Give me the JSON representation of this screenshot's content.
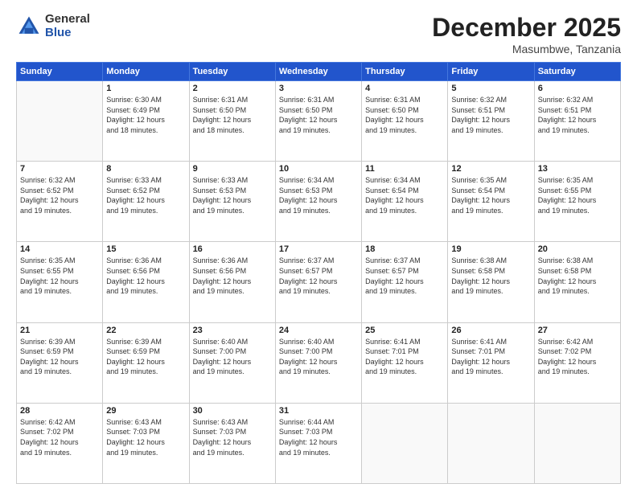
{
  "logo": {
    "general": "General",
    "blue": "Blue"
  },
  "title": {
    "month_year": "December 2025",
    "location": "Masumbwe, Tanzania"
  },
  "days_of_week": [
    "Sunday",
    "Monday",
    "Tuesday",
    "Wednesday",
    "Thursday",
    "Friday",
    "Saturday"
  ],
  "weeks": [
    [
      {
        "day": "",
        "info": ""
      },
      {
        "day": "1",
        "info": "Sunrise: 6:30 AM\nSunset: 6:49 PM\nDaylight: 12 hours\nand 18 minutes."
      },
      {
        "day": "2",
        "info": "Sunrise: 6:31 AM\nSunset: 6:50 PM\nDaylight: 12 hours\nand 18 minutes."
      },
      {
        "day": "3",
        "info": "Sunrise: 6:31 AM\nSunset: 6:50 PM\nDaylight: 12 hours\nand 19 minutes."
      },
      {
        "day": "4",
        "info": "Sunrise: 6:31 AM\nSunset: 6:50 PM\nDaylight: 12 hours\nand 19 minutes."
      },
      {
        "day": "5",
        "info": "Sunrise: 6:32 AM\nSunset: 6:51 PM\nDaylight: 12 hours\nand 19 minutes."
      },
      {
        "day": "6",
        "info": "Sunrise: 6:32 AM\nSunset: 6:51 PM\nDaylight: 12 hours\nand 19 minutes."
      }
    ],
    [
      {
        "day": "7",
        "info": "Sunrise: 6:32 AM\nSunset: 6:52 PM\nDaylight: 12 hours\nand 19 minutes."
      },
      {
        "day": "8",
        "info": "Sunrise: 6:33 AM\nSunset: 6:52 PM\nDaylight: 12 hours\nand 19 minutes."
      },
      {
        "day": "9",
        "info": "Sunrise: 6:33 AM\nSunset: 6:53 PM\nDaylight: 12 hours\nand 19 minutes."
      },
      {
        "day": "10",
        "info": "Sunrise: 6:34 AM\nSunset: 6:53 PM\nDaylight: 12 hours\nand 19 minutes."
      },
      {
        "day": "11",
        "info": "Sunrise: 6:34 AM\nSunset: 6:54 PM\nDaylight: 12 hours\nand 19 minutes."
      },
      {
        "day": "12",
        "info": "Sunrise: 6:35 AM\nSunset: 6:54 PM\nDaylight: 12 hours\nand 19 minutes."
      },
      {
        "day": "13",
        "info": "Sunrise: 6:35 AM\nSunset: 6:55 PM\nDaylight: 12 hours\nand 19 minutes."
      }
    ],
    [
      {
        "day": "14",
        "info": "Sunrise: 6:35 AM\nSunset: 6:55 PM\nDaylight: 12 hours\nand 19 minutes."
      },
      {
        "day": "15",
        "info": "Sunrise: 6:36 AM\nSunset: 6:56 PM\nDaylight: 12 hours\nand 19 minutes."
      },
      {
        "day": "16",
        "info": "Sunrise: 6:36 AM\nSunset: 6:56 PM\nDaylight: 12 hours\nand 19 minutes."
      },
      {
        "day": "17",
        "info": "Sunrise: 6:37 AM\nSunset: 6:57 PM\nDaylight: 12 hours\nand 19 minutes."
      },
      {
        "day": "18",
        "info": "Sunrise: 6:37 AM\nSunset: 6:57 PM\nDaylight: 12 hours\nand 19 minutes."
      },
      {
        "day": "19",
        "info": "Sunrise: 6:38 AM\nSunset: 6:58 PM\nDaylight: 12 hours\nand 19 minutes."
      },
      {
        "day": "20",
        "info": "Sunrise: 6:38 AM\nSunset: 6:58 PM\nDaylight: 12 hours\nand 19 minutes."
      }
    ],
    [
      {
        "day": "21",
        "info": "Sunrise: 6:39 AM\nSunset: 6:59 PM\nDaylight: 12 hours\nand 19 minutes."
      },
      {
        "day": "22",
        "info": "Sunrise: 6:39 AM\nSunset: 6:59 PM\nDaylight: 12 hours\nand 19 minutes."
      },
      {
        "day": "23",
        "info": "Sunrise: 6:40 AM\nSunset: 7:00 PM\nDaylight: 12 hours\nand 19 minutes."
      },
      {
        "day": "24",
        "info": "Sunrise: 6:40 AM\nSunset: 7:00 PM\nDaylight: 12 hours\nand 19 minutes."
      },
      {
        "day": "25",
        "info": "Sunrise: 6:41 AM\nSunset: 7:01 PM\nDaylight: 12 hours\nand 19 minutes."
      },
      {
        "day": "26",
        "info": "Sunrise: 6:41 AM\nSunset: 7:01 PM\nDaylight: 12 hours\nand 19 minutes."
      },
      {
        "day": "27",
        "info": "Sunrise: 6:42 AM\nSunset: 7:02 PM\nDaylight: 12 hours\nand 19 minutes."
      }
    ],
    [
      {
        "day": "28",
        "info": "Sunrise: 6:42 AM\nSunset: 7:02 PM\nDaylight: 12 hours\nand 19 minutes."
      },
      {
        "day": "29",
        "info": "Sunrise: 6:43 AM\nSunset: 7:03 PM\nDaylight: 12 hours\nand 19 minutes."
      },
      {
        "day": "30",
        "info": "Sunrise: 6:43 AM\nSunset: 7:03 PM\nDaylight: 12 hours\nand 19 minutes."
      },
      {
        "day": "31",
        "info": "Sunrise: 6:44 AM\nSunset: 7:03 PM\nDaylight: 12 hours\nand 19 minutes."
      },
      {
        "day": "",
        "info": ""
      },
      {
        "day": "",
        "info": ""
      },
      {
        "day": "",
        "info": ""
      }
    ]
  ]
}
